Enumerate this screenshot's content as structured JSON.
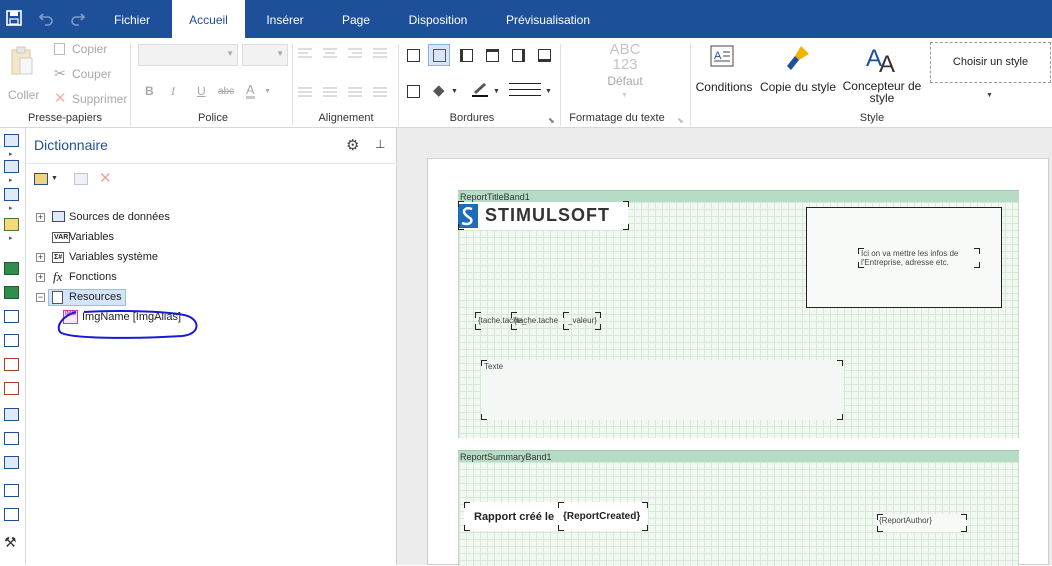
{
  "topbar": {
    "save_icon": "save-icon",
    "undo_icon": "undo-icon",
    "redo_icon": "redo-icon",
    "tabs": [
      {
        "label": "Fichier",
        "active": false
      },
      {
        "label": "Accueil",
        "active": true
      },
      {
        "label": "Insérer",
        "active": false
      },
      {
        "label": "Page",
        "active": false
      },
      {
        "label": "Disposition",
        "active": false
      },
      {
        "label": "Prévisualisation",
        "active": false
      }
    ],
    "color": "#1e4f99"
  },
  "ribbon": {
    "clipboard": {
      "paste": "Coller",
      "copy": "Copier",
      "cut": "Couper",
      "delete": "Supprimer",
      "group": "Presse-papiers"
    },
    "font": {
      "bold": "B",
      "italic": "I",
      "underline": "U",
      "strike": "abc",
      "color": "A",
      "group": "Police"
    },
    "alignment": {
      "group": "Alignement"
    },
    "borders": {
      "group": "Bordures"
    },
    "text_format": {
      "sample_top": "ABC",
      "sample_bottom": "123",
      "value": "Défaut",
      "group": "Formatage du texte"
    },
    "style": {
      "conditions": "Conditions",
      "copy_style": "Copie du style",
      "designer_line1": "Concepteur de",
      "designer_line2": "style",
      "choose_style": "Choisir un style",
      "group": "Style"
    }
  },
  "dictionary": {
    "title": "Dictionnaire",
    "tree": [
      {
        "label": "Sources de données",
        "expander": "+"
      },
      {
        "label": "Variables",
        "expander": ""
      },
      {
        "label": "Variables système",
        "expander": "+"
      },
      {
        "label": "Fonctions",
        "expander": "+"
      },
      {
        "label": "Resources",
        "expander": "−"
      }
    ],
    "resource_item": "ImgName [ImgAlias]",
    "var_badge": "VAR",
    "sys_badge": "Σ#",
    "fx_badge": "fx",
    "img_badge": "IMG",
    "annotation_color": "#1a1ad4"
  },
  "report": {
    "title_band": "ReportTitleBand1",
    "logo_text": "STIMULSOFT",
    "company_info": "Ici on va mettre les infos de l'Entreprise, adresse etc.",
    "field1": "{tache.tache_",
    "field2": "{tache.tache",
    "field3": "_valeur}",
    "texte": "Texte",
    "summary_band": "ReportSummaryBand1",
    "created_label": "Rapport créé le",
    "report_created": "{ReportCreated}",
    "report_author": "{ReportAuthor}"
  }
}
